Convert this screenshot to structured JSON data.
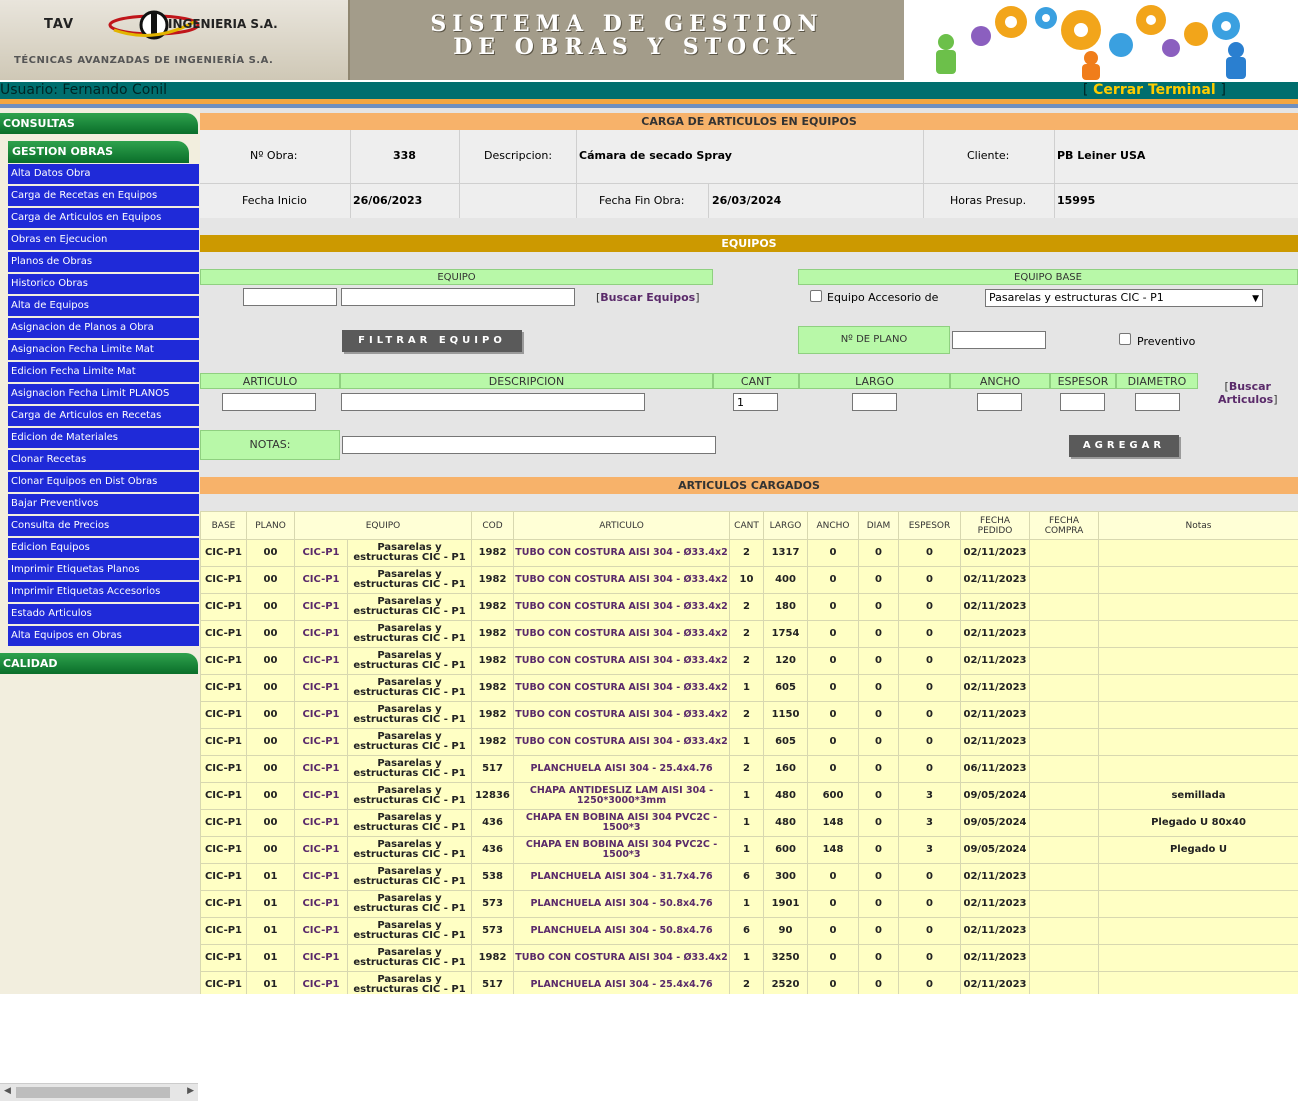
{
  "header": {
    "logo_tav": "TAV",
    "logo_ing": "INGENIERIA S.A.",
    "logo_sub": "TÉCNICAS AVANZADAS DE INGENIERÍA S.A.",
    "title_line1": "SISTEMA DE GESTION",
    "title_line2": "DE OBRAS Y STOCK"
  },
  "userbar": {
    "user": "Usuario: Fernando Conil",
    "bracket_open": "[",
    "cerrar": "Cerrar Terminal",
    "bracket_close": "]"
  },
  "sidebar": {
    "consultas": "CONSULTAS",
    "gestion": "GESTION OBRAS",
    "items": [
      "Alta Datos Obra",
      "Carga de Recetas en Equipos",
      "Carga de Articulos en Equipos",
      "Obras en Ejecucion",
      "Planos de Obras",
      "Historico Obras",
      "Alta de Equipos",
      "Asignacion de Planos a Obra",
      "Asignacion Fecha Limite Mat",
      "Edicion Fecha Limite Mat",
      "Asignacion Fecha Limit PLANOS",
      "Carga de Articulos en Recetas",
      "Edicion de Materiales",
      "Clonar Recetas",
      "Clonar Equipos en Dist Obras",
      "Bajar Preventivos",
      "Consulta de Precios",
      "Edicion Equipos",
      "Imprimir Etiquetas Planos",
      "Imprimir Etiquetas Accesorios",
      "Estado Articulos",
      "Alta Equipos en Obras"
    ],
    "calidad": "CALIDAD"
  },
  "carga": {
    "title": "CARGA DE ARTICULOS EN EQUIPOS",
    "obra_label": "Nº Obra:",
    "obra_value": "338",
    "desc_label": "Descripcion:",
    "desc_value": "Cámara de secado Spray",
    "cliente_label": "Cliente:",
    "cliente_value": "PB Leiner USA",
    "fini_label": "Fecha Inicio",
    "fini_value": "26/06/2023",
    "ffin_label": "Fecha Fin Obra:",
    "ffin_value": "26/03/2024",
    "horas_label": "Horas Presup.",
    "horas_value": "15995"
  },
  "equipos": {
    "title": "EQUIPOS",
    "equipo_label": "EQUIPO",
    "buscar_equipos": "Buscar Equipos",
    "equipo_base_label": "EQUIPO BASE",
    "accesorio_label": "Equipo Accesorio de",
    "base_selected": "Pasarelas y estructuras CIC - P1",
    "filtrar_button": "FILTRAR EQUIPO",
    "plano_label": "Nº DE PLANO",
    "preventivo_label": "Preventivo",
    "articulo_label": "ARTICULO",
    "descripcion_label": "DESCRIPCION",
    "cant_label": "CANT",
    "cant_value": "1",
    "largo_label": "LARGO",
    "ancho_label": "ANCHO",
    "espesor_label": "ESPESOR",
    "diametro_label": "DIAMETRO",
    "buscar_articulos_1": "Buscar",
    "buscar_articulos_2": "Articulos",
    "notas_label": "NOTAS:",
    "agregar_button": "AGREGAR"
  },
  "cargados": {
    "title": "ARTICULOS CARGADOS",
    "columns": [
      "BASE",
      "PLANO",
      "EQUIPO",
      "",
      "COD",
      "ARTICULO",
      "CANT",
      "LARGO",
      "ANCHO",
      "DIAM",
      "ESPESOR",
      "FECHA PEDIDO",
      "FECHA COMPRA",
      "Notas"
    ],
    "rows": [
      [
        "CIC-P1",
        "00",
        "CIC-P1",
        "Pasarelas y estructuras CIC - P1",
        "1982",
        "TUBO CON COSTURA AISI 304 - Ø33.4x2",
        "2",
        "1317",
        "0",
        "0",
        "0",
        "02/11/2023",
        "",
        ""
      ],
      [
        "CIC-P1",
        "00",
        "CIC-P1",
        "Pasarelas y estructuras CIC - P1",
        "1982",
        "TUBO CON COSTURA AISI 304 - Ø33.4x2",
        "10",
        "400",
        "0",
        "0",
        "0",
        "02/11/2023",
        "",
        ""
      ],
      [
        "CIC-P1",
        "00",
        "CIC-P1",
        "Pasarelas y estructuras CIC - P1",
        "1982",
        "TUBO CON COSTURA AISI 304 - Ø33.4x2",
        "2",
        "180",
        "0",
        "0",
        "0",
        "02/11/2023",
        "",
        ""
      ],
      [
        "CIC-P1",
        "00",
        "CIC-P1",
        "Pasarelas y estructuras CIC - P1",
        "1982",
        "TUBO CON COSTURA AISI 304 - Ø33.4x2",
        "2",
        "1754",
        "0",
        "0",
        "0",
        "02/11/2023",
        "",
        ""
      ],
      [
        "CIC-P1",
        "00",
        "CIC-P1",
        "Pasarelas y estructuras CIC - P1",
        "1982",
        "TUBO CON COSTURA AISI 304 - Ø33.4x2",
        "2",
        "120",
        "0",
        "0",
        "0",
        "02/11/2023",
        "",
        ""
      ],
      [
        "CIC-P1",
        "00",
        "CIC-P1",
        "Pasarelas y estructuras CIC - P1",
        "1982",
        "TUBO CON COSTURA AISI 304 - Ø33.4x2",
        "1",
        "605",
        "0",
        "0",
        "0",
        "02/11/2023",
        "",
        ""
      ],
      [
        "CIC-P1",
        "00",
        "CIC-P1",
        "Pasarelas y estructuras CIC - P1",
        "1982",
        "TUBO CON COSTURA AISI 304 - Ø33.4x2",
        "2",
        "1150",
        "0",
        "0",
        "0",
        "02/11/2023",
        "",
        ""
      ],
      [
        "CIC-P1",
        "00",
        "CIC-P1",
        "Pasarelas y estructuras CIC - P1",
        "1982",
        "TUBO CON COSTURA AISI 304 - Ø33.4x2",
        "1",
        "605",
        "0",
        "0",
        "0",
        "02/11/2023",
        "",
        ""
      ],
      [
        "CIC-P1",
        "00",
        "CIC-P1",
        "Pasarelas y estructuras CIC - P1",
        "517",
        "PLANCHUELA AISI 304 - 25.4x4.76",
        "2",
        "160",
        "0",
        "0",
        "0",
        "06/11/2023",
        "",
        ""
      ],
      [
        "CIC-P1",
        "00",
        "CIC-P1",
        "Pasarelas y estructuras CIC - P1",
        "12836",
        "CHAPA ANTIDESLIZ LAM AISI 304 - 1250*3000*3mm",
        "1",
        "480",
        "600",
        "0",
        "3",
        "09/05/2024",
        "",
        "semillada"
      ],
      [
        "CIC-P1",
        "00",
        "CIC-P1",
        "Pasarelas y estructuras CIC - P1",
        "436",
        "CHAPA EN BOBINA AISI 304 PVC2C - 1500*3",
        "1",
        "480",
        "148",
        "0",
        "3",
        "09/05/2024",
        "",
        "Plegado U 80x40"
      ],
      [
        "CIC-P1",
        "00",
        "CIC-P1",
        "Pasarelas y estructuras CIC - P1",
        "436",
        "CHAPA EN BOBINA AISI 304 PVC2C - 1500*3",
        "1",
        "600",
        "148",
        "0",
        "3",
        "09/05/2024",
        "",
        "Plegado U"
      ],
      [
        "CIC-P1",
        "01",
        "CIC-P1",
        "Pasarelas y estructuras CIC - P1",
        "538",
        "PLANCHUELA AISI 304 - 31.7x4.76",
        "6",
        "300",
        "0",
        "0",
        "0",
        "02/11/2023",
        "",
        ""
      ],
      [
        "CIC-P1",
        "01",
        "CIC-P1",
        "Pasarelas y estructuras CIC - P1",
        "573",
        "PLANCHUELA AISI 304 - 50.8x4.76",
        "1",
        "1901",
        "0",
        "0",
        "0",
        "02/11/2023",
        "",
        ""
      ],
      [
        "CIC-P1",
        "01",
        "CIC-P1",
        "Pasarelas y estructuras CIC - P1",
        "573",
        "PLANCHUELA AISI 304 - 50.8x4.76",
        "6",
        "90",
        "0",
        "0",
        "0",
        "02/11/2023",
        "",
        ""
      ],
      [
        "CIC-P1",
        "01",
        "CIC-P1",
        "Pasarelas y estructuras CIC - P1",
        "1982",
        "TUBO CON COSTURA AISI 304 - Ø33.4x2",
        "1",
        "3250",
        "0",
        "0",
        "0",
        "02/11/2023",
        "",
        ""
      ],
      [
        "CIC-P1",
        "01",
        "CIC-P1",
        "Pasarelas y estructuras CIC - P1",
        "517",
        "PLANCHUELA AISI 304 - 25.4x4.76",
        "2",
        "2520",
        "0",
        "0",
        "0",
        "02/11/2023",
        "",
        ""
      ]
    ]
  }
}
